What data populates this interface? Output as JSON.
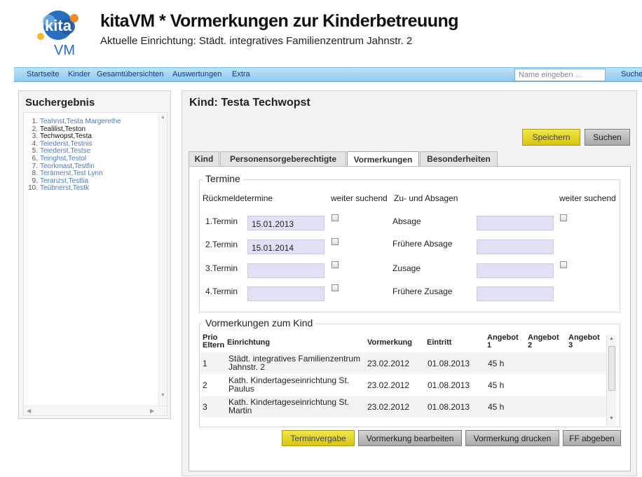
{
  "header": {
    "logo_text_top": "kita",
    "logo_text_bottom": "VM",
    "title": "kitaVM * Vormerkungen zur Kinderbetreuung",
    "subtitle": "Aktuelle Einrichtung: Städt. integratives Familienzentrum Jahnstr. 2"
  },
  "nav": {
    "items": [
      "Startseite",
      "Kinder",
      "Gesamtübersichten",
      "Auswertungen",
      "Extra"
    ],
    "search_placeholder": "Name eingeben ...",
    "search_label": "Suche"
  },
  "sidebar": {
    "title": "Suchergebnis",
    "results": [
      {
        "num": "1.",
        "name": "Teahnst,Testa Margerethe",
        "visited": false
      },
      {
        "num": "2.",
        "name": "Tealilist,Teston",
        "visited": true
      },
      {
        "num": "3.",
        "name": "Techwopst,Testa",
        "visited": true
      },
      {
        "num": "4.",
        "name": "Teiederst,Testnis",
        "visited": false
      },
      {
        "num": "5.",
        "name": "Teiederst,Testse",
        "visited": false
      },
      {
        "num": "6.",
        "name": "Teinghst,Testol",
        "visited": false
      },
      {
        "num": "7.",
        "name": "Teorkmast,Testfin",
        "visited": false
      },
      {
        "num": "8.",
        "name": "Terämerst,Test Lynn",
        "visited": false
      },
      {
        "num": "9.",
        "name": "Teranzst,Testlia",
        "visited": false
      },
      {
        "num": "10.",
        "name": "Teübnerst,Testk",
        "visited": false
      }
    ]
  },
  "main": {
    "title": "Kind: Testa Techwopst",
    "save_label": "Speichern",
    "search_label": "Suchen",
    "tabs": [
      {
        "label": "Kind"
      },
      {
        "label": "Personensorgeberechtigte"
      },
      {
        "label": "Vormerkungen"
      },
      {
        "label": "Besonderheiten"
      }
    ],
    "active_tab": "Vormerkungen",
    "termine": {
      "legend": "Termine",
      "col_rueckmelde": "Rückmeldetermine",
      "col_weiter1": "weiter suchend",
      "col_zusagen": "Zu- und Absagen",
      "col_weiter2": "weiter suchend",
      "rows": [
        {
          "label": "1.Termin",
          "value": "15.01.2013",
          "right_label": "Absage",
          "right_value": ""
        },
        {
          "label": "2.Termin",
          "value": "15.01.2014",
          "right_label": "Frühere Absage",
          "right_value": ""
        },
        {
          "label": "3.Termin",
          "value": "",
          "right_label": "Zusage",
          "right_value": ""
        },
        {
          "label": "4.Termin",
          "value": "",
          "right_label": "Frühere Zusage",
          "right_value": ""
        }
      ]
    },
    "vormerkungen": {
      "legend": "Vormerkungen zum Kind",
      "headers": {
        "prio_line1": "Prio",
        "prio_line2": "Eltern",
        "einrichtung": "Einrichtung",
        "vormerkung": "Vormerkung",
        "eintritt": "Eintritt",
        "angebot1_line1": "Angebot",
        "angebot1_line2": "1",
        "angebot2_line1": "Angebot",
        "angebot2_line2": "2",
        "angebot3_line1": "Angebot",
        "angebot3_line2": "3"
      },
      "rows": [
        {
          "prio": "1",
          "einrichtung_line1": "Städt. integratives Familienzentrum",
          "einrichtung_line2": "Jahnstr. 2",
          "vormerkung": "23.02.2012",
          "eintritt": "01.08.2013",
          "angebot1": "45 h"
        },
        {
          "prio": "2",
          "einrichtung_line1": "Kath. Kindertageseinrichtung St.",
          "einrichtung_line2": "Paulus",
          "vormerkung": "23.02.2012",
          "eintritt": "01.08.2013",
          "angebot1": "45 h"
        },
        {
          "prio": "3",
          "einrichtung_line1": "Kath. Kindertageseinrichtung St.",
          "einrichtung_line2": "Martin",
          "vormerkung": "23.02.2012",
          "eintritt": "01.08.2013",
          "angebot1": "45 h"
        }
      ]
    },
    "actions": {
      "terminvergabe": "Terminvergabe",
      "vormerkung_bearbeiten": "Vormerkung bearbeiten",
      "vormerkung_drucken": "Vormerkung drucken",
      "ff_abgeben": "FF abgeben"
    },
    "colors": {
      "accent_yellow": "#e6d622",
      "field_bg": "#e1e1f6",
      "nav_blue": "#8ec9ec",
      "link_blue": "#4a7bbf"
    }
  }
}
